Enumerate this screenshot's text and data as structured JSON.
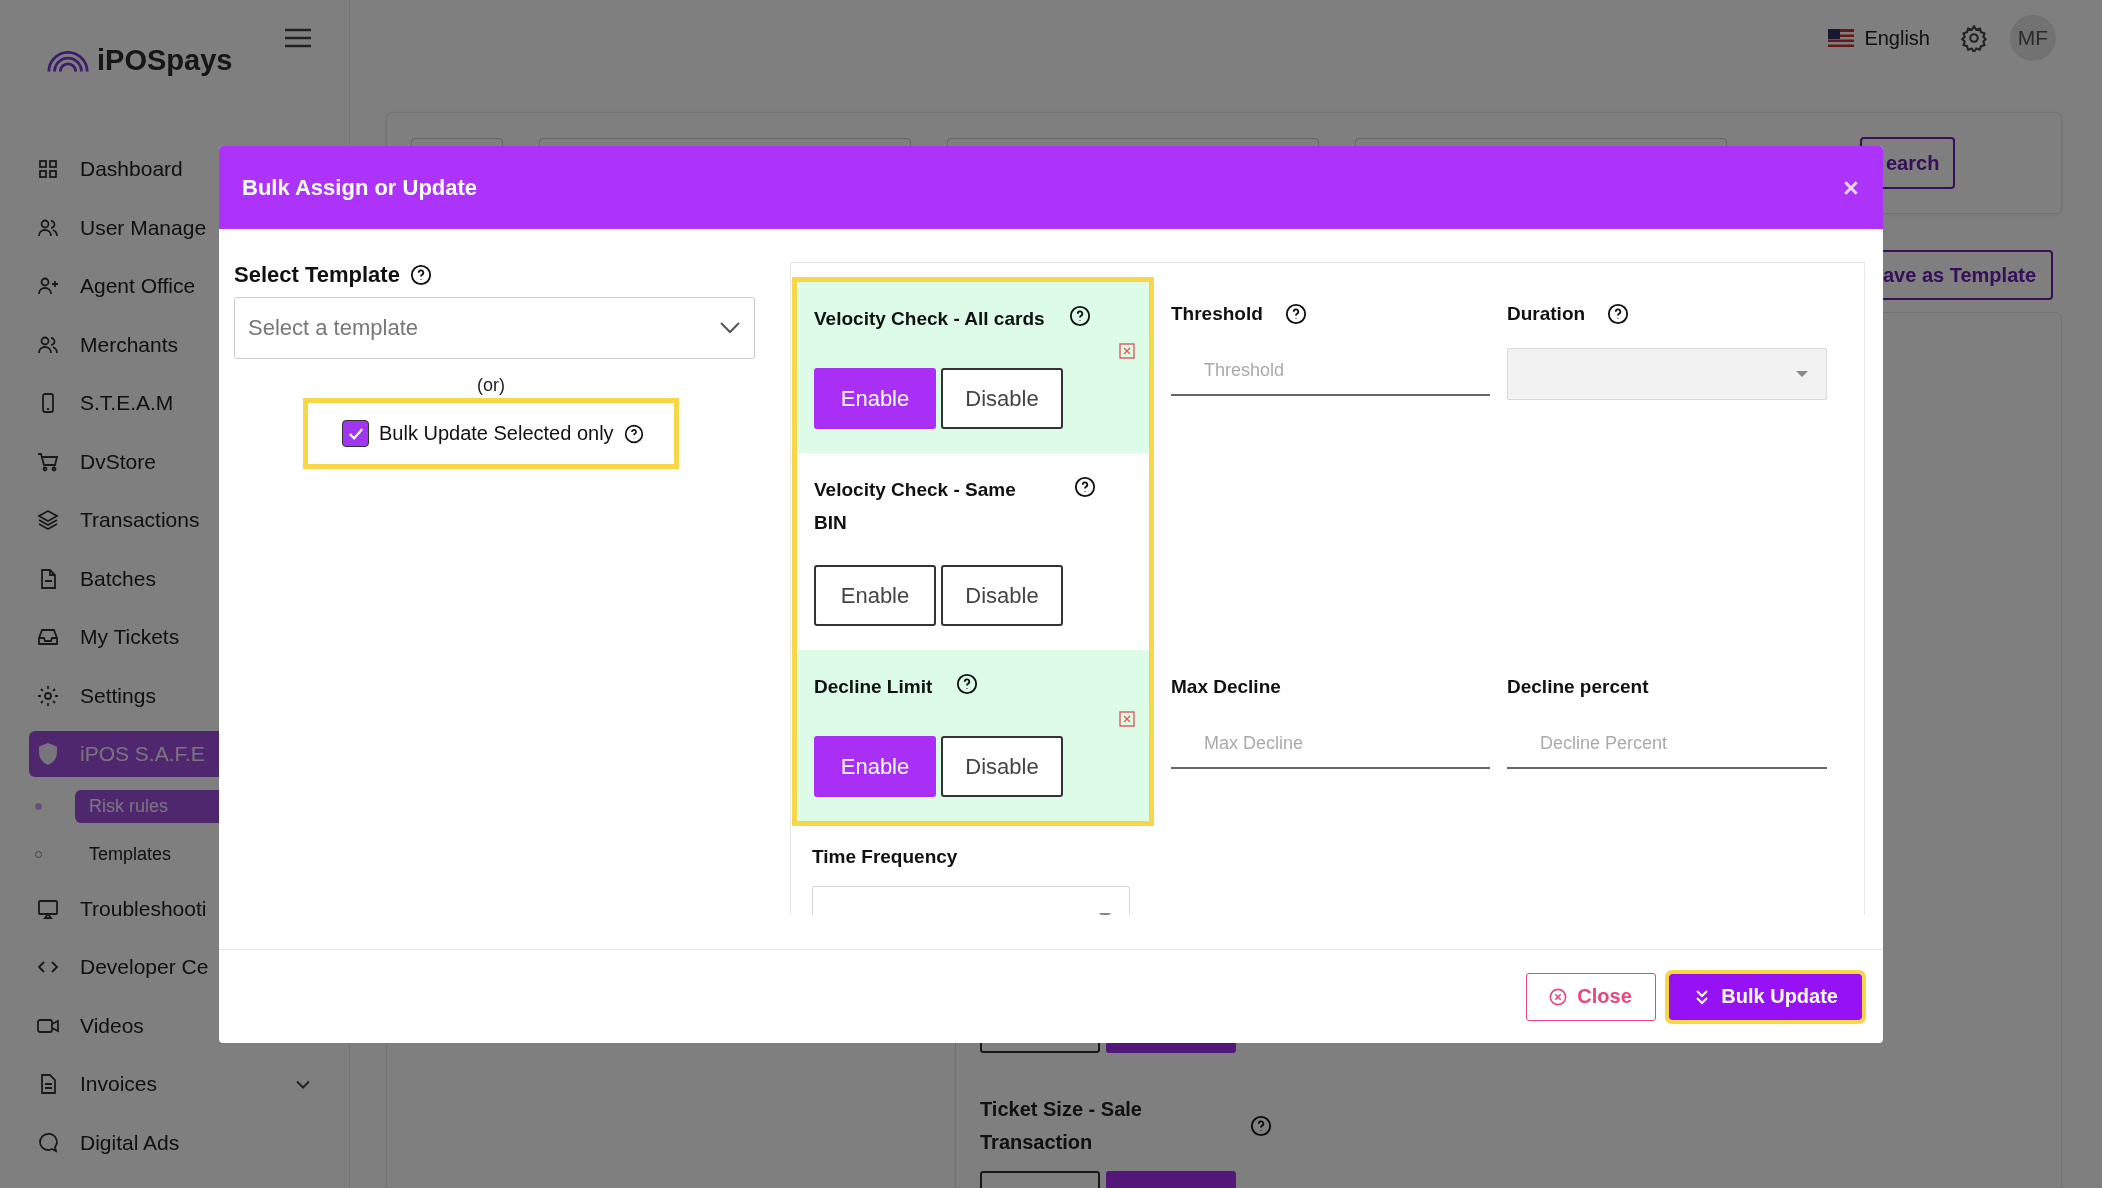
{
  "header": {
    "language": "English",
    "avatar": "MF"
  },
  "sidebar": {
    "logo": "iPOSpays",
    "items": [
      {
        "label": "Dashboard",
        "selected": false
      },
      {
        "label": "User Manage",
        "selected": false
      },
      {
        "label": "Agent Office",
        "selected": false
      },
      {
        "label": "Merchants",
        "selected": false
      },
      {
        "label": "S.T.E.A.M",
        "selected": false
      },
      {
        "label": "DvStore",
        "selected": false
      },
      {
        "label": "Transactions",
        "selected": false
      },
      {
        "label": "Batches",
        "selected": false
      },
      {
        "label": "My Tickets",
        "selected": false
      },
      {
        "label": "Settings",
        "selected": false
      },
      {
        "label": "iPOS S.A.F.E",
        "selected": true,
        "expanded": true,
        "children": [
          {
            "label": "Risk rules",
            "selected": true
          },
          {
            "label": "Templates",
            "selected": false
          }
        ]
      },
      {
        "label": "Troubleshooti",
        "selected": false
      },
      {
        "label": "Developer Ce",
        "selected": false
      },
      {
        "label": "Videos",
        "selected": false
      },
      {
        "label": "Invoices",
        "selected": false,
        "expanded": false
      },
      {
        "label": "Digital Ads",
        "selected": false
      }
    ]
  },
  "page": {
    "search_button": "earch",
    "save_template_button": "ave as Template",
    "rule_title": "Ticket Size - Sale Transaction"
  },
  "modal": {
    "title": "Bulk Assign or Update",
    "template": {
      "label": "Select Template",
      "placeholder": "Select a template"
    },
    "or": "(or)",
    "bulk_selected": {
      "label": "Bulk Update Selected only",
      "checked": true,
      "highlighted": true
    },
    "rules_highlighted": true,
    "rules": [
      {
        "title": "Velocity Check - All cards",
        "options": [
          {
            "label": "Enable",
            "selected": true
          },
          {
            "label": "Disable",
            "selected": false
          }
        ],
        "fields": [
          {
            "kind": "input",
            "label": "Threshold",
            "help": true,
            "placeholder": "Threshold"
          },
          {
            "kind": "select",
            "label": "Duration",
            "help": true,
            "disabled": true
          }
        ]
      },
      {
        "title": "Velocity Check - Same BIN",
        "options": [
          {
            "label": "Enable",
            "selected": false
          },
          {
            "label": "Disable",
            "selected": false
          }
        ]
      },
      {
        "title": "Decline Limit",
        "options": [
          {
            "label": "Enable",
            "selected": true
          },
          {
            "label": "Disable",
            "selected": false
          }
        ],
        "fields": [
          {
            "kind": "input",
            "label": "Max Decline",
            "help": false,
            "placeholder": "Max Decline"
          },
          {
            "kind": "input",
            "label": "Decline percent",
            "help": false,
            "placeholder": "Decline Percent"
          }
        ]
      }
    ],
    "more_fields": [
      {
        "kind": "select",
        "label": "Time Frequency",
        "help": false,
        "disabled": false
      }
    ],
    "buttons": [
      {
        "kind": "close",
        "label": "Close",
        "highlighted": false
      },
      {
        "kind": "bulk",
        "label": "Bulk Update",
        "highlighted": true
      }
    ]
  }
}
